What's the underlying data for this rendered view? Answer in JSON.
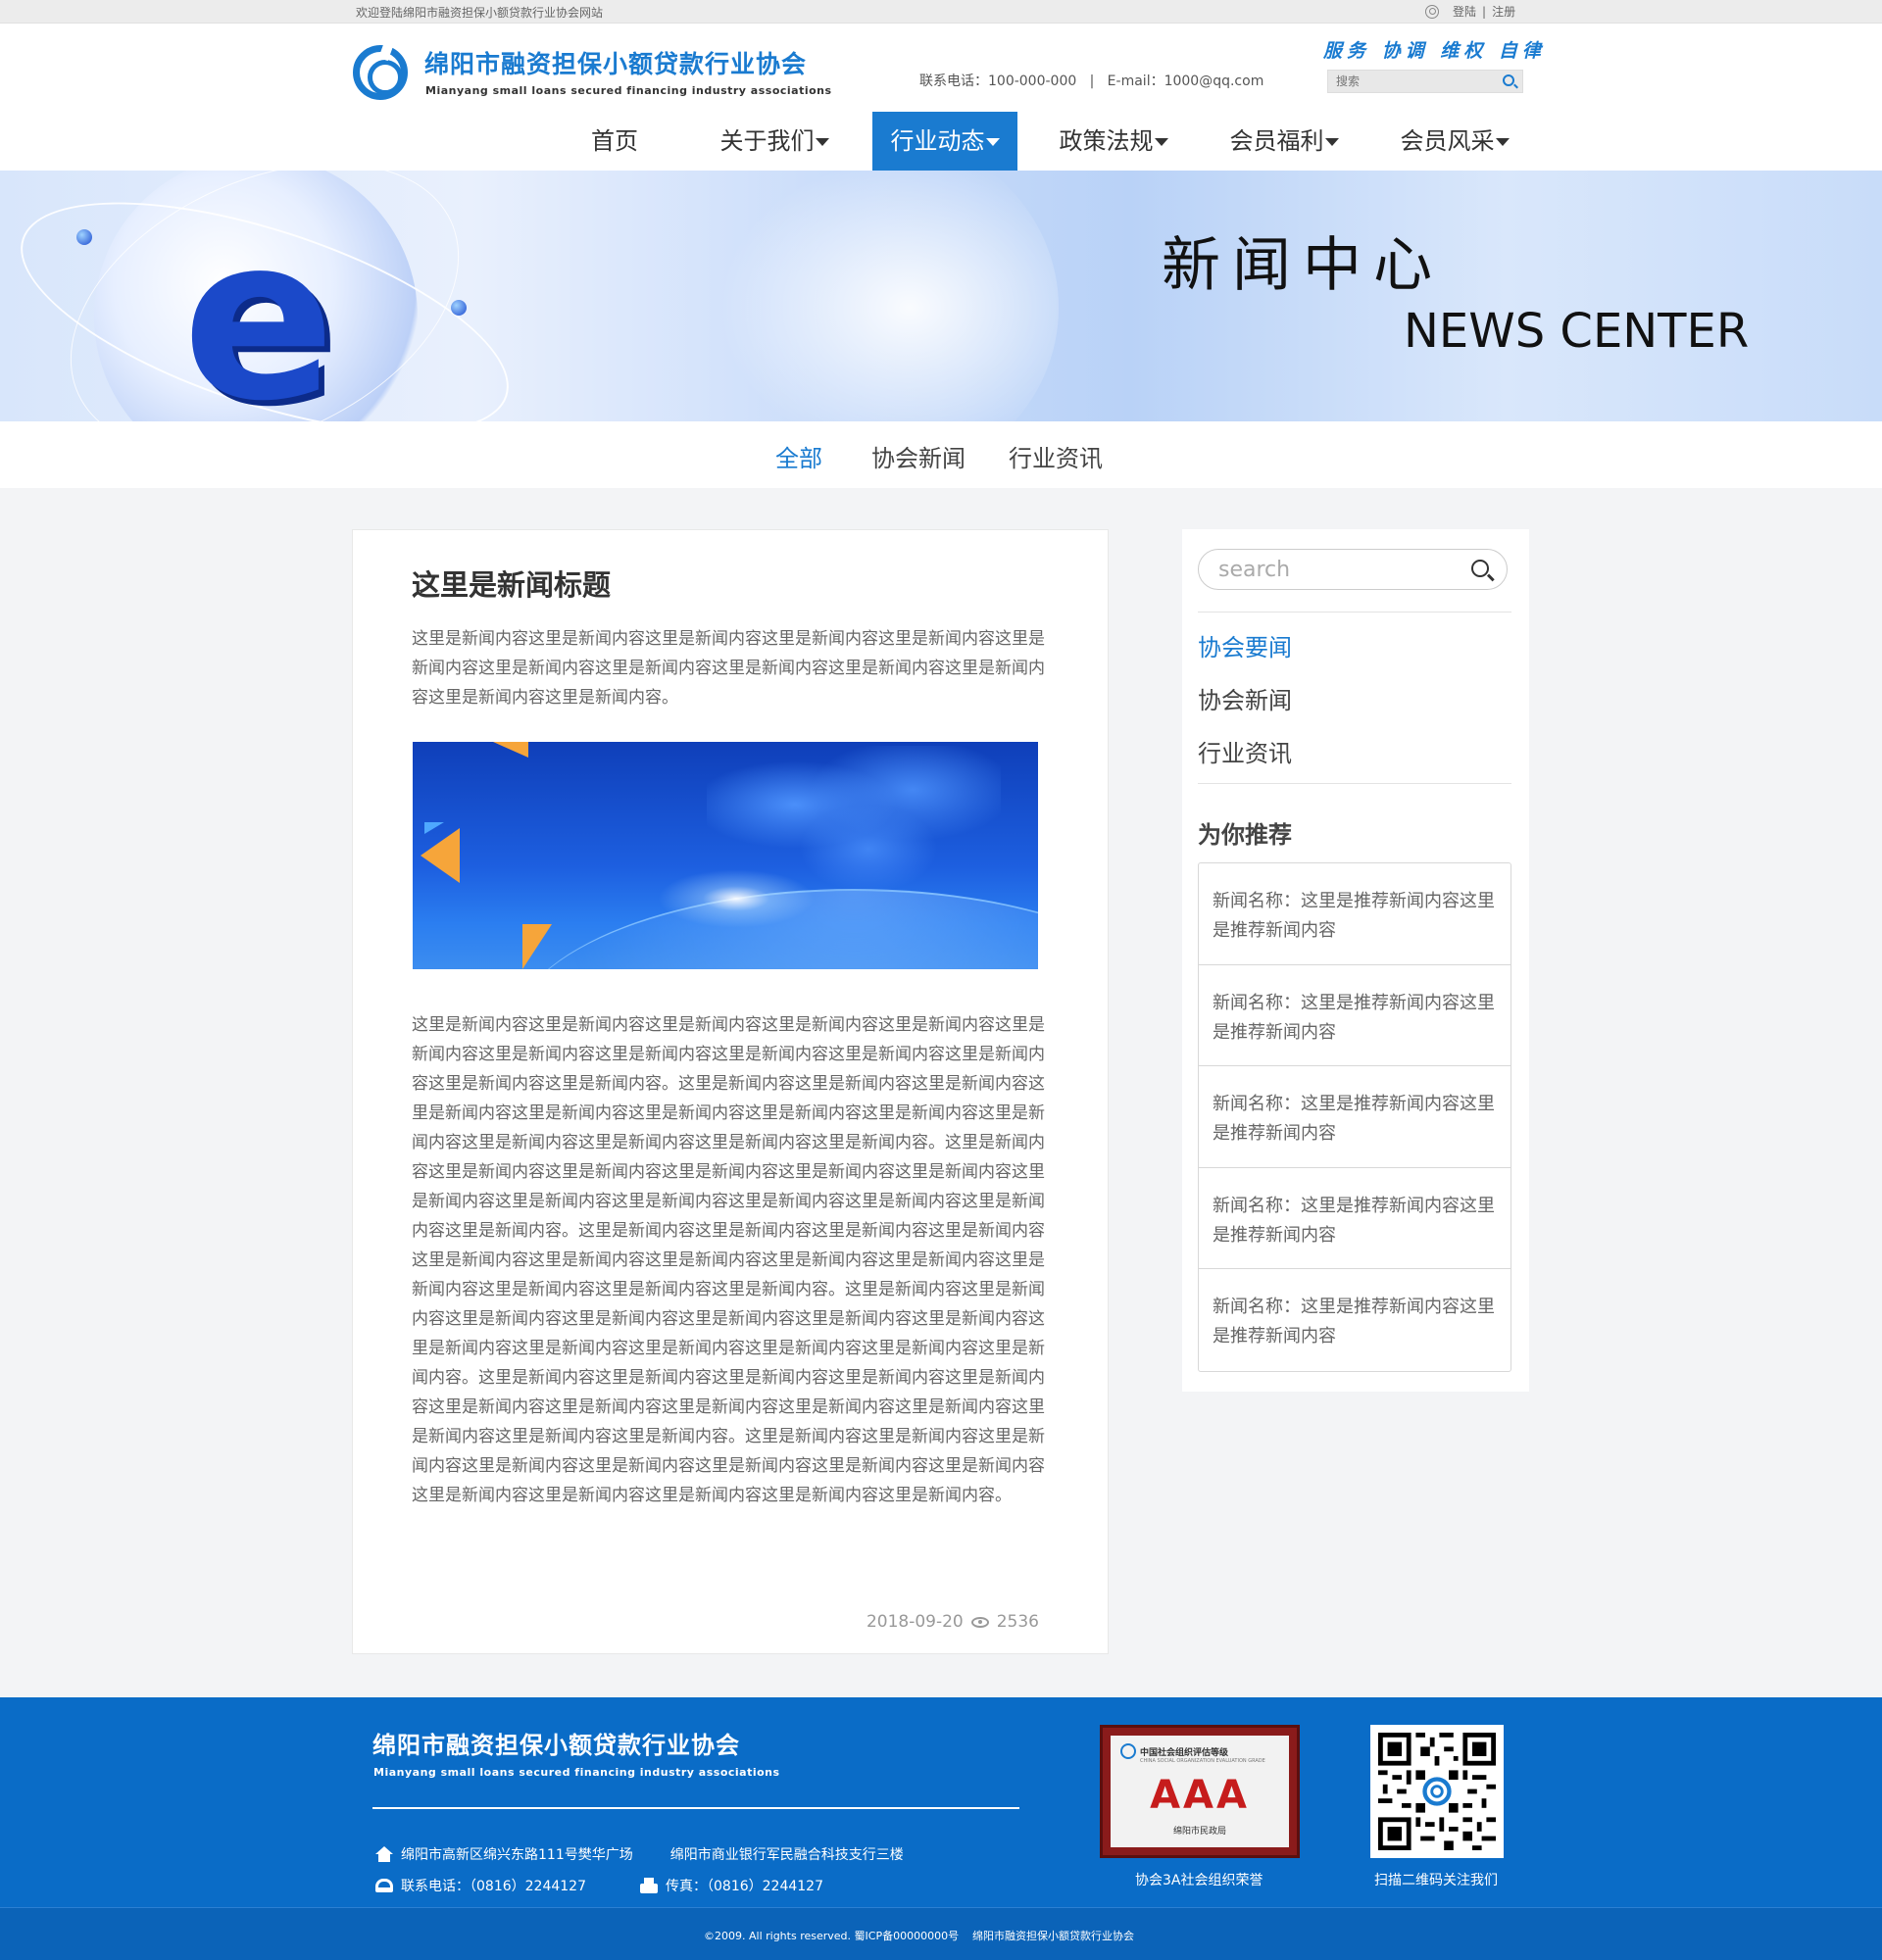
{
  "topbar": {
    "welcome": "欢迎登陆绵阳市融资担保小额贷款行业协会网站",
    "login": "登陆",
    "separator": "|",
    "register": "注册"
  },
  "header": {
    "logo_cn": "绵阳市融资担保小额贷款行业协会",
    "logo_en": "Mianyang small loans secured financing industry associations",
    "contact": "联系电话：100-000-000   |   E-mail：1000@qq.com",
    "slogan": "服务 协调 维权 自律",
    "search_placeholder": "搜索"
  },
  "nav": {
    "items": [
      {
        "label": "首页",
        "dropdown": false,
        "active": false
      },
      {
        "label": "关于我们",
        "dropdown": true,
        "active": false
      },
      {
        "label": "行业动态",
        "dropdown": true,
        "active": true
      },
      {
        "label": "政策法规",
        "dropdown": true,
        "active": false
      },
      {
        "label": "会员福利",
        "dropdown": true,
        "active": false
      },
      {
        "label": "会员风采",
        "dropdown": true,
        "active": false
      }
    ]
  },
  "banner": {
    "title_cn": "新闻中心",
    "title_en": "NEWS CENTER"
  },
  "subtabs": {
    "items": [
      {
        "label": "全部",
        "active": true
      },
      {
        "label": "协会新闻",
        "active": false
      },
      {
        "label": "行业资讯",
        "active": false
      }
    ]
  },
  "article": {
    "title": "这里是新闻标题",
    "paragraph1": "这里是新闻内容这里是新闻内容这里是新闻内容这里是新闻内容这里是新闻内容这里是新闻内容这里是新闻内容这里是新闻内容这里是新闻内容这里是新闻内容这里是新闻内容这里是新闻内容这里是新闻内容。",
    "paragraph2": "这里是新闻内容这里是新闻内容这里是新闻内容这里是新闻内容这里是新闻内容这里是新闻内容这里是新闻内容这里是新闻内容这里是新闻内容这里是新闻内容这里是新闻内容这里是新闻内容这里是新闻内容。这里是新闻内容这里是新闻内容这里是新闻内容这里是新闻内容这里是新闻内容这里是新闻内容这里是新闻内容这里是新闻内容这里是新闻内容这里是新闻内容这里是新闻内容这里是新闻内容这里是新闻内容。这里是新闻内容这里是新闻内容这里是新闻内容这里是新闻内容这里是新闻内容这里是新闻内容这里是新闻内容这里是新闻内容这里是新闻内容这里是新闻内容这里是新闻内容这里是新闻内容这里是新闻内容。这里是新闻内容这里是新闻内容这里是新闻内容这里是新闻内容这里是新闻内容这里是新闻内容这里是新闻内容这里是新闻内容这里是新闻内容这里是新闻内容这里是新闻内容这里是新闻内容这里是新闻内容。这里是新闻内容这里是新闻内容这里是新闻内容这里是新闻内容这里是新闻内容这里是新闻内容这里是新闻内容这里是新闻内容这里是新闻内容这里是新闻内容这里是新闻内容这里是新闻内容这里是新闻内容。这里是新闻内容这里是新闻内容这里是新闻内容这里是新闻内容这里是新闻内容这里是新闻内容这里是新闻内容这里是新闻内容这里是新闻内容这里是新闻内容这里是新闻内容这里是新闻内容这里是新闻内容。这里是新闻内容这里是新闻内容这里是新闻内容这里是新闻内容这里是新闻内容这里是新闻内容这里是新闻内容这里是新闻内容这里是新闻内容这里是新闻内容这里是新闻内容这里是新闻内容这里是新闻内容。",
    "date": "2018-09-20",
    "views": "2536"
  },
  "sidebar": {
    "search_placeholder": "search",
    "categories": [
      {
        "label": "协会要闻",
        "active": true
      },
      {
        "label": "协会新闻",
        "active": false
      },
      {
        "label": "行业资讯",
        "active": false
      }
    ],
    "recommend_title": "为你推荐",
    "recommend": [
      "新闻名称：这里是推荐新闻内容这里是推荐新闻内容",
      "新闻名称：这里是推荐新闻内容这里是推荐新闻内容",
      "新闻名称：这里是推荐新闻内容这里是推荐新闻内容",
      "新闻名称：这里是推荐新闻内容这里是推荐新闻内容",
      "新闻名称：这里是推荐新闻内容这里是推荐新闻内容"
    ]
  },
  "footer": {
    "name_cn": "绵阳市融资担保小额贷款行业协会",
    "name_en": "Mianyang small loans secured financing industry associations",
    "address1": "绵阳市高新区绵兴东路111号樊华广场",
    "address2": "绵阳市商业银行军民融合科技支行三楼",
    "phone": "联系电话：（0816）2244127",
    "fax": "传真：（0816）2244127",
    "cert_title": "中国社会组织评估等级",
    "cert_subtitle": "CHINA SOCIAL ORGANIZATION EVALUATION GRADE",
    "cert_grade": "AAA",
    "cert_org": "绵阳市民政局",
    "cert_caption": "协会3A社会组织荣誉",
    "qr_caption": "扫描二维码关注我们",
    "copyright": "©2009. All rights reserved. 蜀ICP备00000000号",
    "copyright_org": "绵阳市融资担保小额贷款行业协会"
  }
}
